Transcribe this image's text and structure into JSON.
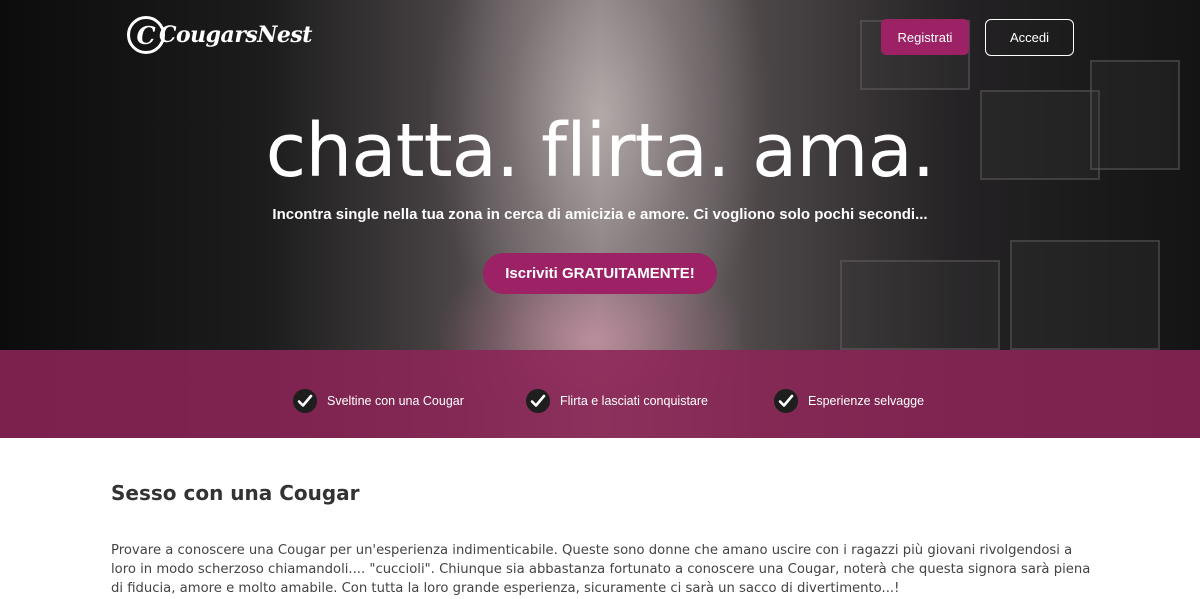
{
  "header": {
    "logo_text": "CougarsNest",
    "logo_letter": "C",
    "register_label": "Registrati",
    "login_label": "Accedi"
  },
  "hero": {
    "headline": "chatta. flirta. ama.",
    "subheadline": "Incontra single nella tua zona in cerca di amicizia e amore. Ci vogliono solo pochi secondi...",
    "cta_label": "Iscriviti GRATUITAMENTE!"
  },
  "features": [
    {
      "label": "Sveltine con una Cougar",
      "icon": "check-icon"
    },
    {
      "label": "Flirta e lasciati conquistare",
      "icon": "check-icon"
    },
    {
      "label": "Esperienze selvagge",
      "icon": "check-icon"
    }
  ],
  "content": {
    "title": "Sesso con una Cougar",
    "body": "Provare a conoscere una Cougar per un'esperienza indimenticabile. Queste sono donne che amano uscire con i ragazzi più giovani rivolgendosi a loro in modo scherzoso chiamandoli.... \"cuccioli\". Chiunque sia abbastanza fortunato a conoscere una Cougar, noterà che questa signora sarà piena di fiducia, amore e molto amabile. Con tutta la loro grande esperienza, sicuramente ci sarà un sacco di divertimento...!"
  },
  "colors": {
    "accent": "#9c2265",
    "band": "#8c2457",
    "text_dark": "#333333"
  }
}
